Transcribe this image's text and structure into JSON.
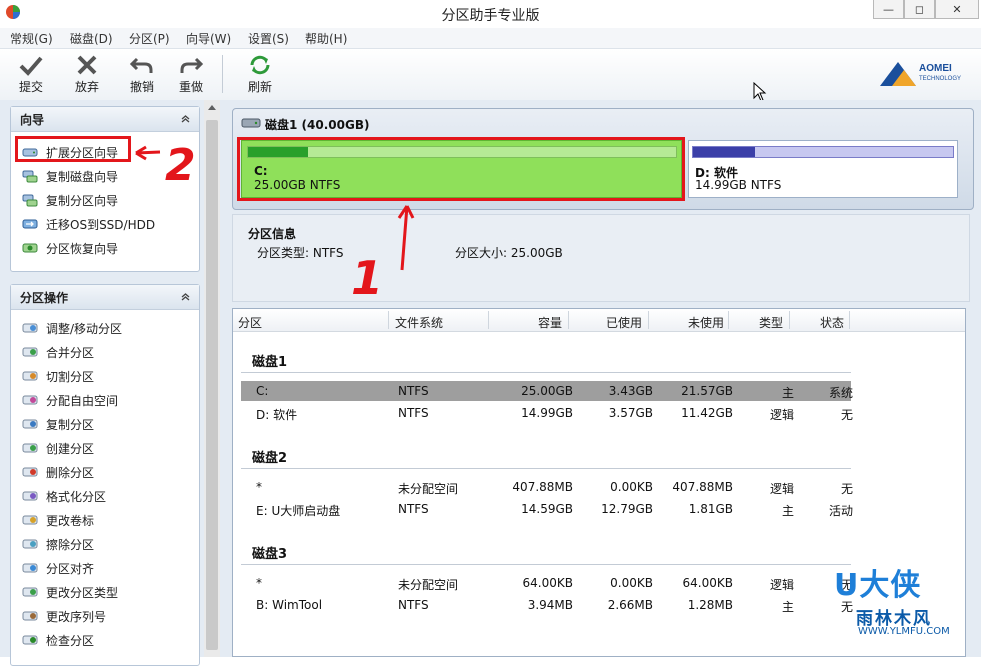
{
  "window": {
    "title": "分区助手专业版",
    "min": "▭",
    "max": "◻",
    "close": "✕"
  },
  "menu": [
    "常规(G)",
    "磁盘(D)",
    "分区(P)",
    "向导(W)",
    "设置(S)",
    "帮助(H)"
  ],
  "toolbar": {
    "submit": "提交",
    "discard": "放弃",
    "undo": "撤销",
    "redo": "重做",
    "refresh": "刷新"
  },
  "logo": {
    "name": "AOMEI",
    "sub": "TECHNOLOGY"
  },
  "wizard_panel": {
    "title": "向导",
    "items": [
      "扩展分区向导",
      "复制磁盘向导",
      "复制分区向导",
      "迁移OS到SSD/HDD",
      "分区恢复向导"
    ]
  },
  "ops_panel": {
    "title": "分区操作",
    "items": [
      "调整/移动分区",
      "合并分区",
      "切割分区",
      "分配自由空间",
      "复制分区",
      "创建分区",
      "删除分区",
      "格式化分区",
      "更改卷标",
      "擦除分区",
      "分区对齐",
      "更改分区类型",
      "更改序列号",
      "检查分区"
    ]
  },
  "disk_map": {
    "title": "磁盘1 (40.00GB)",
    "partitions": [
      {
        "name": "C:",
        "desc": "25.00GB NTFS",
        "used_fraction": 0.14
      },
      {
        "name": "D: 软件",
        "desc": "14.99GB NTFS",
        "used_fraction": 0.24
      }
    ]
  },
  "info": {
    "title": "分区信息",
    "type": "分区类型: NTFS",
    "size": "分区大小: 25.00GB"
  },
  "table": {
    "headers": [
      "分区",
      "文件系统",
      "容量",
      "已使用",
      "未使用",
      "类型",
      "状态"
    ],
    "groups": [
      {
        "name": "磁盘1",
        "rows": [
          [
            "C:",
            "NTFS",
            "25.00GB",
            "3.43GB",
            "21.57GB",
            "主",
            "系统"
          ],
          [
            "D: 软件",
            "NTFS",
            "14.99GB",
            "3.57GB",
            "11.42GB",
            "逻辑",
            "无"
          ]
        ]
      },
      {
        "name": "磁盘2",
        "rows": [
          [
            "*",
            "未分配空间",
            "407.88MB",
            "0.00KB",
            "407.88MB",
            "逻辑",
            "无"
          ],
          [
            "E: U大师启动盘",
            "NTFS",
            "14.59GB",
            "12.79GB",
            "1.81GB",
            "主",
            "活动"
          ]
        ]
      },
      {
        "name": "磁盘3",
        "rows": [
          [
            "*",
            "未分配空间",
            "64.00KB",
            "0.00KB",
            "64.00KB",
            "逻辑",
            "无"
          ],
          [
            "B: WimTool",
            "NTFS",
            "3.94MB",
            "2.66MB",
            "1.28MB",
            "主",
            "无"
          ]
        ]
      }
    ]
  },
  "annotations": {
    "step1": "1",
    "step2": "2"
  },
  "watermark": {
    "top": "U大侠",
    "bottom": "雨林木风",
    "url": "WWW.YLMFU.COM"
  },
  "colors": {
    "partition_c": "#8fe05a",
    "partition_d_used": "#3b3fa8",
    "highlight": "#e3161b"
  }
}
